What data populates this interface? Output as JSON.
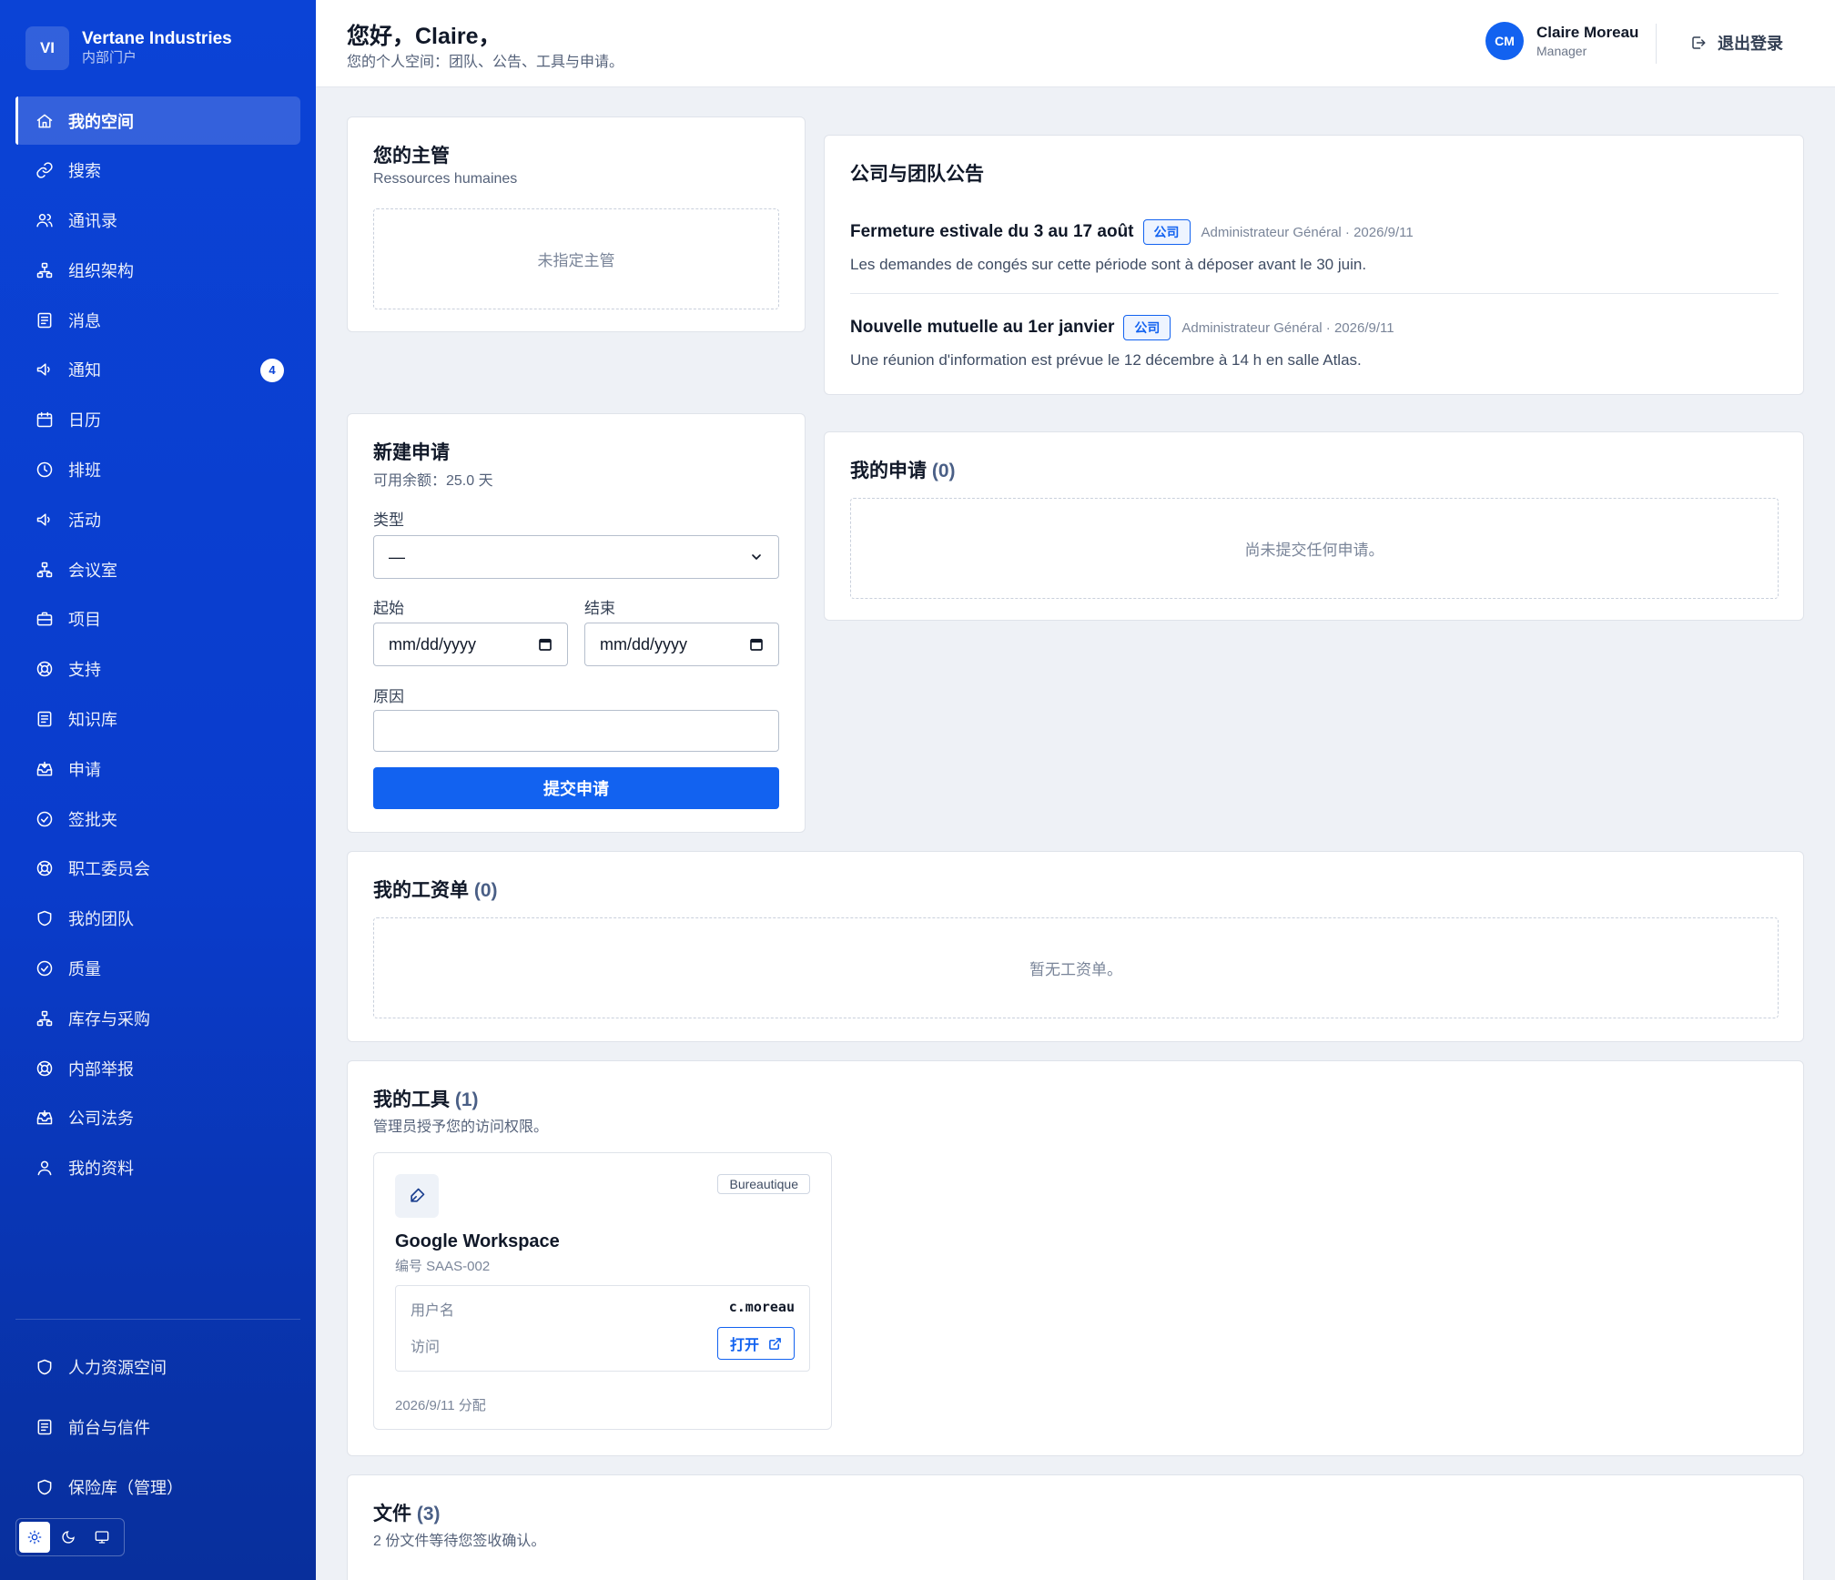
{
  "brand": {
    "initials": "VI",
    "name": "Vertane Industries",
    "subtitle": "内部门户"
  },
  "nav": [
    {
      "label": "我的空间",
      "icon": "home",
      "active": true
    },
    {
      "label": "搜索",
      "icon": "link"
    },
    {
      "label": "通讯录",
      "icon": "users"
    },
    {
      "label": "组织架构",
      "icon": "org"
    },
    {
      "label": "消息",
      "icon": "document"
    },
    {
      "label": "通知",
      "icon": "megaphone",
      "badge": "4"
    },
    {
      "label": "日历",
      "icon": "calendar"
    },
    {
      "label": "排班",
      "icon": "clock"
    },
    {
      "label": "活动",
      "icon": "megaphone"
    },
    {
      "label": "会议室",
      "icon": "org"
    },
    {
      "label": "项目",
      "icon": "briefcase"
    },
    {
      "label": "支持",
      "icon": "lifebuoy"
    },
    {
      "label": "知识库",
      "icon": "document"
    },
    {
      "label": "申请",
      "icon": "inbox"
    },
    {
      "label": "签批夹",
      "icon": "check-circle"
    },
    {
      "label": "职工委员会",
      "icon": "lifebuoy"
    },
    {
      "label": "我的团队",
      "icon": "shield"
    },
    {
      "label": "质量",
      "icon": "check-circle"
    },
    {
      "label": "库存与采购",
      "icon": "org"
    },
    {
      "label": "内部举报",
      "icon": "lifebuoy"
    },
    {
      "label": "公司法务",
      "icon": "inbox"
    },
    {
      "label": "我的资料",
      "icon": "user"
    }
  ],
  "nav_bottom": [
    {
      "label": "人力资源空间",
      "icon": "shield"
    },
    {
      "label": "前台与信件",
      "icon": "document"
    },
    {
      "label": "保险库（管理）",
      "icon": "shield"
    }
  ],
  "theme": {
    "options": [
      "sun-icon",
      "moon-icon",
      "monitor-icon"
    ],
    "selected": "light"
  },
  "header": {
    "greeting": "您好，Claire，",
    "subtitle": "您的个人空间：团队、公告、工具与申请。"
  },
  "user": {
    "initials": "CM",
    "name": "Claire Moreau",
    "role": "Manager"
  },
  "logout_label": "退出登录",
  "manager_card": {
    "title": "您的主管",
    "subtitle": "Ressources humaines",
    "empty": "未指定主管"
  },
  "announcements": {
    "title": "公司与团队公告",
    "items": [
      {
        "title": "Fermeture estivale du 3 au 17 août",
        "tag": "公司",
        "meta": "Administrateur Général · 2026/9/11",
        "body": "Les demandes de congés sur cette période sont à déposer avant le 30 juin."
      },
      {
        "title": "Nouvelle mutuelle au 1er janvier",
        "tag": "公司",
        "meta": "Administrateur Général · 2026/9/11",
        "body": "Une réunion d'information est prévue le 12 décembre à 14 h en salle Atlas."
      }
    ]
  },
  "new_request": {
    "title": "新建申请",
    "balance": "可用余额：25.0 天",
    "type_label": "类型",
    "type_value": "—",
    "start_label": "起始",
    "start_placeholder": "mm/dd/yyyy",
    "end_label": "结束",
    "end_placeholder": "mm/dd/yyyy",
    "reason_label": "原因",
    "reason_value": "",
    "submit_label": "提交申请"
  },
  "my_requests": {
    "title": "我的申请",
    "count": "(0)",
    "empty": "尚未提交任何申请。"
  },
  "payslips": {
    "title": "我的工资单",
    "count": "(0)",
    "empty": "暂无工资单。"
  },
  "tools": {
    "title": "我的工具",
    "count": "(1)",
    "subtitle": "管理员授予您的访问权限。",
    "items": [
      {
        "icon": "pen-icon",
        "tag": "Bureautique",
        "name": "Google Workspace",
        "id": "编号 SAAS-002",
        "username_label": "用户名",
        "username": "c.moreau",
        "access_label": "访问",
        "open_label": "打开",
        "assigned": "2026/9/11 分配"
      }
    ]
  },
  "files": {
    "title": "文件",
    "count": "(3)",
    "subtitle": "2 份文件等待您签收确认。"
  },
  "colors": {
    "sidebar": "#0b43d6",
    "accent": "#1262f0",
    "background": "#eef1f6"
  }
}
